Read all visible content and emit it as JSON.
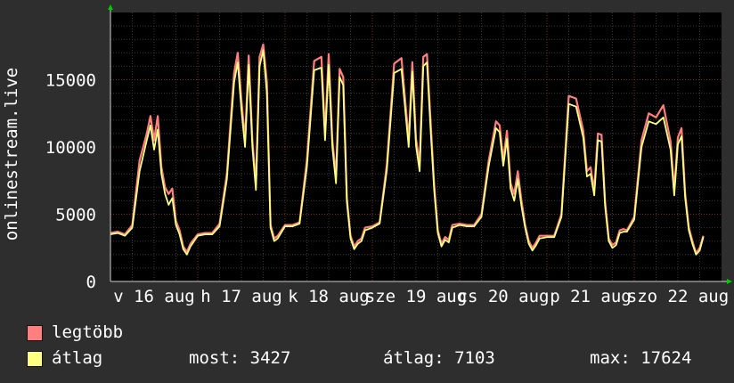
{
  "chart_data": {
    "type": "line",
    "ylabel": "onlinestream.live",
    "ylim": [
      0,
      20000
    ],
    "y_ticks": [
      0,
      5000,
      10000,
      15000
    ],
    "x_tick_labels": [
      "v 16 aug",
      "h 17 aug",
      "k 18 aug",
      "sze 19 aug",
      "cs 20 aug",
      "p 21 aug",
      "szo 22 aug"
    ],
    "grid": true,
    "series": [
      {
        "name": "legtöbb",
        "color": "#ff7f7f",
        "x_hours": [
          0,
          2,
          4,
          6,
          8,
          10,
          11,
          12,
          13,
          14,
          15,
          16,
          17,
          18,
          19,
          20,
          21,
          22,
          24,
          26,
          28,
          30,
          32,
          34,
          35,
          36,
          37,
          38,
          39,
          40,
          41,
          42,
          43,
          44,
          45,
          46,
          48,
          50,
          52,
          54,
          56,
          58,
          59,
          60,
          61,
          62,
          63,
          64,
          65,
          66,
          67,
          68,
          69,
          70,
          72,
          74,
          76,
          78,
          80,
          82,
          83,
          84,
          85,
          86,
          87,
          88,
          89,
          90,
          91,
          92,
          93,
          94,
          96,
          98,
          100,
          102,
          104,
          106,
          107,
          108,
          109,
          110,
          111,
          112,
          113,
          114,
          115,
          116,
          117,
          118,
          120,
          122,
          124,
          126,
          128,
          130,
          131,
          132,
          133,
          134,
          135,
          136,
          137,
          138,
          139,
          140,
          141,
          142,
          144,
          146,
          148,
          150,
          152,
          154,
          155,
          156,
          157,
          158,
          159,
          160,
          161,
          162,
          163,
          164,
          165,
          166,
          168
        ],
        "values": [
          3600,
          3700,
          3500,
          4200,
          9000,
          11000,
          12300,
          10500,
          12300,
          8500,
          7000,
          6500,
          6900,
          4500,
          3800,
          2600,
          2200,
          2800,
          3500,
          3600,
          3600,
          4300,
          8000,
          15500,
          17000,
          13500,
          10500,
          16800,
          10500,
          7200,
          16700,
          17624,
          14800,
          4200,
          3200,
          3400,
          4200,
          4200,
          4400,
          9000,
          16400,
          16700,
          11000,
          16900,
          10500,
          7800,
          15800,
          15200,
          6200,
          3400,
          2600,
          3000,
          3200,
          4000,
          4100,
          4400,
          8700,
          16200,
          16600,
          10500,
          16300,
          10600,
          8800,
          16700,
          16900,
          12000,
          7200,
          3800,
          2800,
          3300,
          3100,
          4200,
          4300,
          4200,
          4200,
          5000,
          9000,
          11900,
          11600,
          9000,
          11200,
          7300,
          6500,
          8200,
          6000,
          4200,
          3000,
          2500,
          2900,
          3400,
          3400,
          3400,
          5000,
          13800,
          13600,
          11200,
          8200,
          8500,
          6800,
          11000,
          10900,
          5900,
          3200,
          2700,
          2900,
          3800,
          3900,
          3800,
          4800,
          10500,
          12500,
          12200,
          13100,
          10400,
          6800,
          10700,
          11400,
          6500,
          4000,
          3000,
          2100,
          2500,
          3400
        ]
      },
      {
        "name": "átlag",
        "color": "#ffff80",
        "x_hours": [
          0,
          2,
          4,
          6,
          8,
          10,
          11,
          12,
          13,
          14,
          15,
          16,
          17,
          18,
          19,
          20,
          21,
          22,
          24,
          26,
          28,
          30,
          32,
          34,
          35,
          36,
          37,
          38,
          39,
          40,
          41,
          42,
          43,
          44,
          45,
          46,
          48,
          50,
          52,
          54,
          56,
          58,
          59,
          60,
          61,
          62,
          63,
          64,
          65,
          66,
          67,
          68,
          69,
          70,
          72,
          74,
          76,
          78,
          80,
          82,
          83,
          84,
          85,
          86,
          87,
          88,
          89,
          90,
          91,
          92,
          93,
          94,
          96,
          98,
          100,
          102,
          104,
          106,
          107,
          108,
          109,
          110,
          111,
          112,
          113,
          114,
          115,
          116,
          117,
          118,
          120,
          122,
          124,
          126,
          128,
          130,
          131,
          132,
          133,
          134,
          135,
          136,
          137,
          138,
          139,
          140,
          141,
          142,
          144,
          146,
          148,
          150,
          152,
          154,
          155,
          156,
          157,
          158,
          159,
          160,
          161,
          162,
          163,
          164,
          165,
          166,
          168
        ],
        "values": [
          3500,
          3600,
          3400,
          4000,
          8200,
          10500,
          11600,
          9800,
          11300,
          8000,
          6500,
          5700,
          6200,
          4200,
          3500,
          2400,
          2000,
          2600,
          3400,
          3500,
          3500,
          4100,
          7600,
          14800,
          16300,
          12800,
          10000,
          16100,
          10000,
          6800,
          16000,
          17200,
          14000,
          4000,
          3000,
          3200,
          4100,
          4100,
          4300,
          8500,
          15700,
          15900,
          10500,
          16100,
          10000,
          7300,
          15200,
          14600,
          5900,
          3200,
          2400,
          2800,
          3000,
          3800,
          4000,
          4300,
          8300,
          15500,
          15800,
          10000,
          15600,
          10100,
          8200,
          16000,
          16300,
          11400,
          6800,
          3600,
          2600,
          3100,
          2900,
          4000,
          4200,
          4100,
          4100,
          4800,
          8600,
          11400,
          11100,
          8600,
          10600,
          6900,
          6000,
          7600,
          5600,
          4000,
          2800,
          2300,
          2700,
          3200,
          3300,
          3300,
          4800,
          13200,
          13000,
          10700,
          7800,
          8000,
          6400,
          10500,
          10400,
          5600,
          3000,
          2500,
          2700,
          3600,
          3700,
          3700,
          4600,
          10000,
          11900,
          11700,
          12200,
          9800,
          6400,
          10200,
          10800,
          6200,
          3800,
          2800,
          2000,
          2300,
          3300
        ]
      }
    ]
  },
  "legend": [
    {
      "label": "legtöbb",
      "color": "#ff7f7f"
    },
    {
      "label": "átlag",
      "color": "#ffff80"
    }
  ],
  "stats": {
    "most": "most: 3427",
    "atlag": "átlag: 7103",
    "max": "max: 17624"
  }
}
